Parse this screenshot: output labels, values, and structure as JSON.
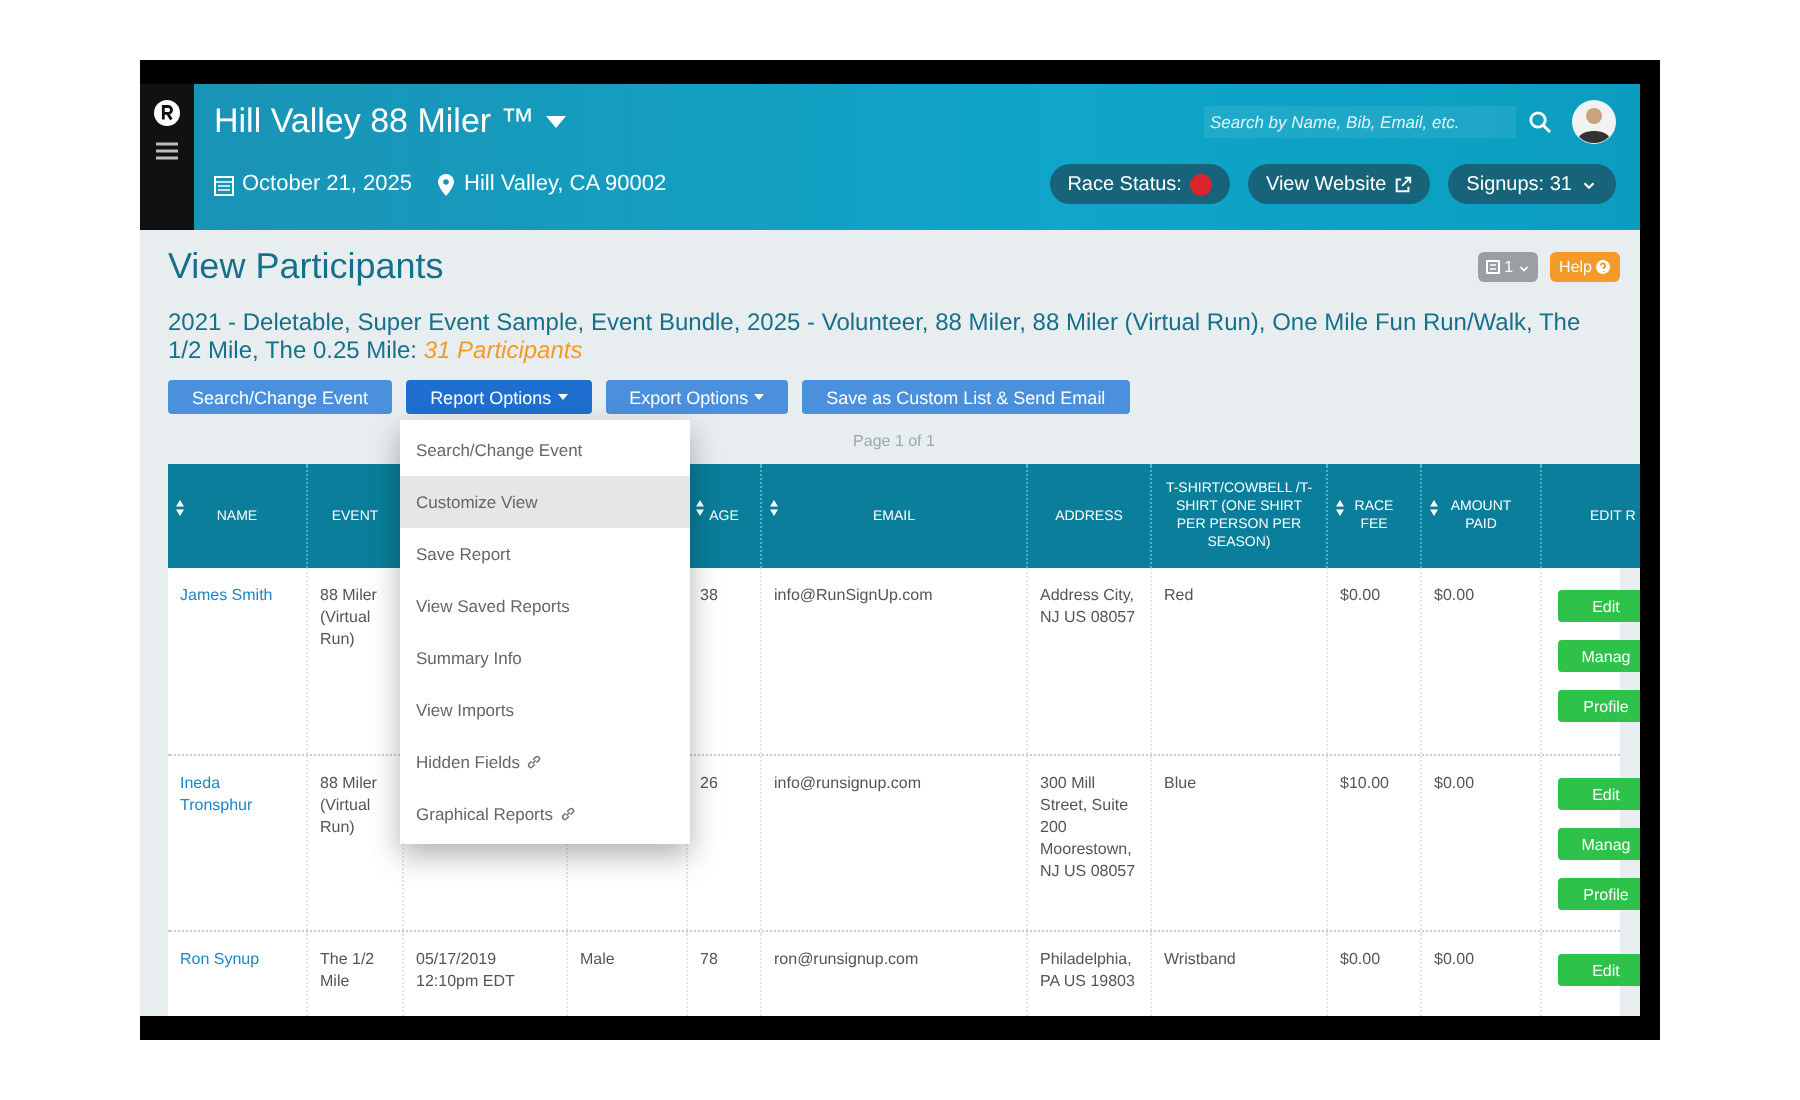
{
  "header": {
    "title": "Hill Valley 88 Miler ™",
    "date": "October 21, 2025",
    "location": "Hill Valley, CA 90002",
    "search": {
      "placeholder": "Search by Name, Bib, Email, etc."
    },
    "pills": [
      {
        "kind": "status",
        "label": "Race Status:",
        "color": "#d9262c"
      },
      {
        "kind": "link",
        "label": "View Website"
      },
      {
        "kind": "menu",
        "label": "Signups: 31"
      }
    ]
  },
  "page": {
    "title": "View Participants",
    "counter": "1",
    "help": "Help",
    "events": "2021 - Deletable, Super Event Sample, Event Bundle, 2025 - Volunteer, 88 Miler, 88 Miler (Virtual Run), One Mile Fun Run/Walk, The 1/2 Mile, The 0.25 Mile: ",
    "participants": "31 Participants"
  },
  "toolbar": [
    {
      "label": "Search/Change Event",
      "dropdown": false,
      "selected": false
    },
    {
      "label": "Report Options",
      "dropdown": true,
      "selected": true
    },
    {
      "label": "Export Options",
      "dropdown": true,
      "selected": false
    },
    {
      "label": "Save as Custom List & Send Email",
      "dropdown": false,
      "selected": false
    }
  ],
  "report_menu": [
    {
      "label": "Search/Change Event",
      "highlighted": false,
      "link": false
    },
    {
      "label": "Customize View",
      "highlighted": true,
      "link": false
    },
    {
      "label": "Save Report",
      "highlighted": false,
      "link": false
    },
    {
      "label": "View Saved Reports",
      "highlighted": false,
      "link": false
    },
    {
      "label": "Summary Info",
      "highlighted": false,
      "link": false
    },
    {
      "label": "View Imports",
      "highlighted": false,
      "link": false
    },
    {
      "label": "Hidden Fields",
      "highlighted": false,
      "link": true
    },
    {
      "label": "Graphical Reports",
      "highlighted": false,
      "link": true
    }
  ],
  "pagination": "Page 1 of 1",
  "table": {
    "columns": [
      {
        "label": "NAME",
        "sortable": true
      },
      {
        "label": "EVENT",
        "sortable": false
      },
      {},
      {},
      {
        "label": "AGE",
        "sortable": true
      },
      {
        "label": "EMAIL",
        "sortable": true
      },
      {
        "label": "ADDRESS",
        "sortable": false
      },
      {
        "label": "T-SHIRT/COWBELL /T-SHIRT (ONE SHIRT PER PERSON PER SEASON)",
        "sortable": false
      },
      {
        "label": "RACE FEE",
        "sortable": true
      },
      {
        "label": "AMOUNT PAID",
        "sortable": true
      },
      {
        "label": "EDIT R",
        "sortable": false
      }
    ],
    "rows": [
      {
        "cells": [
          "James Smith",
          "88 Miler (Virtual Run)",
          null,
          null,
          "38",
          "info@RunSignUp.com",
          "Address City, NJ US 08057",
          "Red",
          "$0.00",
          "$0.00"
        ],
        "actions": [
          "Edit",
          "Manag",
          "Profile"
        ]
      },
      {
        "cells": [
          "Ineda Tronsphur",
          "88 Miler (Virtual Run)",
          null,
          null,
          "26",
          "info@runsignup.com",
          "300 Mill Street, Suite 200 Moorestown, NJ US 08057",
          "Blue",
          "$10.00",
          "$0.00"
        ],
        "actions": [
          "Edit",
          "Manag",
          "Profile"
        ]
      },
      {
        "cells": [
          "Ron Synup",
          "The 1/2 Mile",
          "05/17/2019 12:10pm EDT",
          "Male",
          "78",
          "ron@runsignup.com",
          "Philadelphia, PA US 19803",
          "Wristband",
          "$0.00",
          "$0.00"
        ],
        "actions": [
          "Edit"
        ]
      }
    ]
  }
}
